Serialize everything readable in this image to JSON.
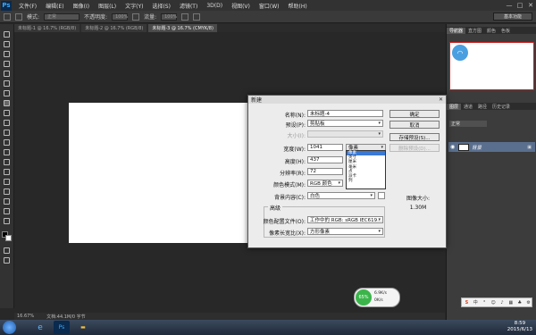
{
  "menubar": {
    "logo": "Ps",
    "items": [
      "文件(F)",
      "编辑(E)",
      "图像(I)",
      "图层(L)",
      "文字(Y)",
      "选择(S)",
      "滤镜(T)",
      "3D(D)",
      "视图(V)",
      "窗口(W)",
      "帮助(H)"
    ],
    "min": "—",
    "max": "□",
    "close": "✕"
  },
  "optbar": {
    "mode_label": "模式:",
    "mode_value": "正常",
    "opacity_label": "不透明度:",
    "opacity_value": "100%",
    "flow_label": "流量:",
    "flow_value": "100%",
    "workspace": "基本功能"
  },
  "tabs": [
    {
      "label": "未标题-1 @ 16.7% (RGB/8)",
      "active": false
    },
    {
      "label": "未标题-2 @ 16.7% (RGB/8)",
      "active": false
    },
    {
      "label": "未标题-3 @ 16.7% (CMYK/8)",
      "active": true
    }
  ],
  "statusbar": {
    "zoom": "16.67%",
    "doc": "文档:44.1M/0 字节"
  },
  "panels": {
    "nav_tabs": [
      "导航器",
      "直方图",
      "颜色",
      "色板"
    ],
    "layer_tabs": [
      "图层",
      "通道",
      "路径",
      "历史记录"
    ],
    "blend_mode": "正常",
    "layer_name": "背景"
  },
  "dialog": {
    "title": "新建",
    "close": "✕",
    "name_label": "名称(N):",
    "name_value": "未标题-4",
    "preset_label": "预设(P):",
    "preset_value": "剪贴板",
    "size_label": "大小(I):",
    "size_value": "",
    "width_label": "宽度(W):",
    "width_value": "1041",
    "height_label": "高度(H):",
    "height_value": "437",
    "res_label": "分辨率(R):",
    "res_value": "72",
    "mode_label": "颜色模式(M):",
    "mode_value": "RGB 颜色",
    "bit_value": "8 位",
    "bg_label": "背景内容(C):",
    "bg_value": "白色",
    "advanced_label": "高级",
    "profile_label": "颜色配置文件(O):",
    "profile_value": "工作中的 RGB: sRGB IEC619...",
    "aspect_label": "像素长宽比(X):",
    "aspect_value": "方形像素",
    "unit_selected": "像素",
    "unit_options": [
      "像素",
      "英寸",
      "厘米",
      "毫米",
      "点",
      "派卡",
      "列"
    ],
    "buttons": {
      "ok": "确定",
      "cancel": "取消",
      "save": "存储预设(S)...",
      "delete": "删除预设(D)..."
    },
    "image_size_label": "图像大小:",
    "image_size_value": "1.30M"
  },
  "netwidget": {
    "percent": "65%",
    "up": "6.9K/s",
    "down": "0K/s"
  },
  "taskbar": {
    "time": "8:59",
    "date": "2015/6/13"
  }
}
